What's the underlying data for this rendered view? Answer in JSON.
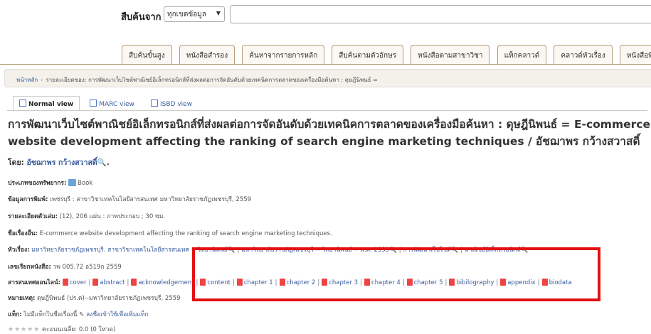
{
  "search": {
    "label": "สืบค้นจาก",
    "scope_value": "ทุกเขตข้อมูล",
    "query_value": ""
  },
  "tabs": [
    {
      "label": "สืบค้นขั้นสูง"
    },
    {
      "label": "หนังสือสำรอง"
    },
    {
      "label": "ค้นหาจากรายการหลัก"
    },
    {
      "label": "สืบค้นตามตัวอักษร"
    },
    {
      "label": "หนังสือตามสาขาวิชา"
    },
    {
      "label": "แท็กคลาวด์"
    },
    {
      "label": "คลาวด์หัวเรื่อง"
    },
    {
      "label": "หนังสือที่ได้รั"
    }
  ],
  "breadcrumb": {
    "home": "หน้าหลัก",
    "current": "รายละเอียดของ: การพัฒนาเว็บไซต์พาณิชย์อิเล็กทรอนิกส์ที่ส่งผลต่อการจัดอันดับด้วยเทคนิคการตลาดของเครื่องมือค้นหา : ดุษฎีนิพนธ์ ="
  },
  "view_tabs": [
    {
      "label": "Normal view"
    },
    {
      "label": "MARC view"
    },
    {
      "label": "ISBD view"
    }
  ],
  "title": "การพัฒนาเว็บไซต์พาณิชย์อิเล็กทรอนิกส์ที่ส่งผลต่อการจัดอันดับด้วยเทคนิคการตลาดของเครื่องมือค้นหา : ดุษฎีนิพนธ์ = E-commerce website development affecting the ranking of search engine marketing techniques / อัชฌาพร กว้างสวาสดิ์",
  "author": {
    "label": "โดย:",
    "name": "อัชฌาพร กว้างสวาสดิ์",
    "suffix": "."
  },
  "record": {
    "material_type": {
      "label": "ประเภทของทรัพยากร:",
      "value": "Book"
    },
    "publication": {
      "label": "ข้อมูลการพิมพ์:",
      "value": "เพชรบุรี : สาขาวิชาเทคโนโลยีสารสนเทศ มหาวิทยาลัยราชภัฏเพชรบุรี, 2559"
    },
    "description": {
      "label": "รายละเอียดตัวเล่ม:",
      "value": "(12), 206 แผ่น : ภาพประกอบ ; 30 ซม."
    },
    "other_title": {
      "label": "ชื่อเรื่องอื่น:",
      "value": "E-commerce website development affecting the ranking of search engine marketing techniques."
    },
    "subjects": {
      "label": "หัวเรื่อง:",
      "items": [
        "มหาวิทยาลัยราชภัฏเพชรบุรี. สาขาวิชาเทคโนโลยีสารสนเทศ -- วิทยานิพนธ์",
        "มหาวิทยาลัยราชภัฏเพชรบุรี -- วิทยานิพนธ์ -- พ.ศ. 2559",
        "การพัฒนาเว็บไซต์",
        "พาณิชย์อิเล็กทรอนิกส์"
      ]
    },
    "call_number": {
      "label": "เลขเรียกหนังสือ:",
      "value": "วพ 005.72 อ519ก 2559"
    },
    "online_resources": {
      "label": "สารสนเทศออนไลน์:",
      "items": [
        "cover",
        "abstract",
        "acknowledgement",
        "content",
        "chapter 1",
        "chapter 2",
        "chapter 3",
        "chapter 4",
        "chapter 5",
        "bibilography",
        "appendix",
        "biodata"
      ]
    },
    "notes": {
      "label": "หมายเหตุ:",
      "value": "ดุษฎีนิพนธ์ (ปร.ด)--มหาวิทยาลัยราชภัฏเพชรบุรี, 2559"
    },
    "tags": {
      "label": "แท็ก:",
      "value": "ไม่มีแท็กในชื่อเรื่องนี้",
      "action": "ลงชื่อเข้าใช้เพื่อเพิ่มแท็ก"
    },
    "rating": {
      "value": "คะแนนเฉลี่ย: 0.0 (0 โหวต)"
    }
  }
}
